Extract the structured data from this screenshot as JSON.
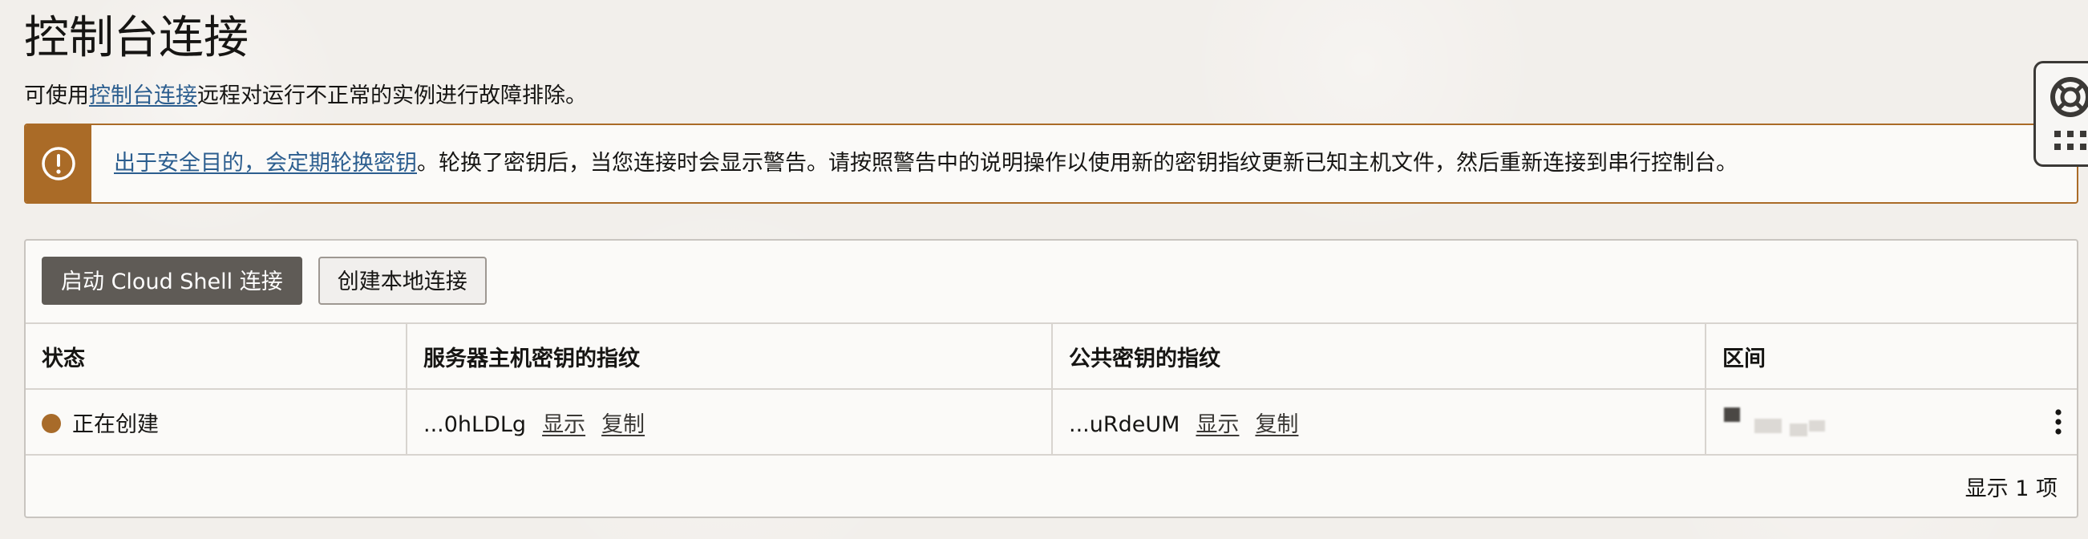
{
  "page": {
    "title": "控制台连接",
    "desc_prefix": "可使用",
    "desc_link": "控制台连接",
    "desc_suffix": "远程对运行不正常的实例进行故障排除。"
  },
  "warning": {
    "link": "出于安全目的，会定期轮换密钥",
    "text": "。轮换了密钥后，当您连接时会显示警告。请按照警告中的说明操作以使用新的密钥指纹更新已知主机文件，然后重新连接到串行控制台。",
    "icon": "exclamation-icon"
  },
  "toolbar": {
    "cloud_shell_label": "启动 Cloud Shell 连接",
    "local_label": "创建本地连接"
  },
  "table": {
    "headers": [
      "状态",
      "服务器主机密钥的指纹",
      "公共密钥的指纹",
      "区间"
    ],
    "rows": [
      {
        "status": "正在创建",
        "server_fp": "...0hLDLg",
        "public_fp": "...uRdeUM",
        "show_label": "显示",
        "copy_label": "复制"
      }
    ]
  },
  "footer": {
    "count_text": "显示 1 项"
  },
  "colors": {
    "accent": "#aa6b27",
    "link": "#2c5e8f",
    "primary_button": "#5f5b56"
  }
}
